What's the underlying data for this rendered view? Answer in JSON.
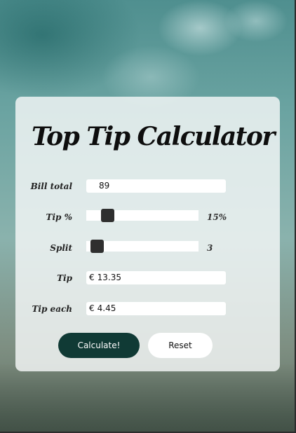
{
  "app": {
    "title": "Top Tip Calculator"
  },
  "fields": {
    "bill_total": {
      "label": "Bill total",
      "value": "89"
    },
    "tip_percent": {
      "label": "Tip %",
      "value": 15,
      "display": "15%",
      "min": 0,
      "max": 100
    },
    "split": {
      "label": "Split",
      "value": 3,
      "display": "3",
      "min": 1,
      "max": 50
    },
    "tip": {
      "label": "Tip",
      "currency": "€",
      "value": "13.35"
    },
    "tip_each": {
      "label": "Tip each",
      "currency": "€",
      "value": "4.45"
    }
  },
  "buttons": {
    "calculate": "Calculate!",
    "reset": "Reset"
  },
  "colors": {
    "primary_button": "#103a35",
    "slider_thumb": "#2f2f2f",
    "card_background": "#f5f8f8"
  }
}
